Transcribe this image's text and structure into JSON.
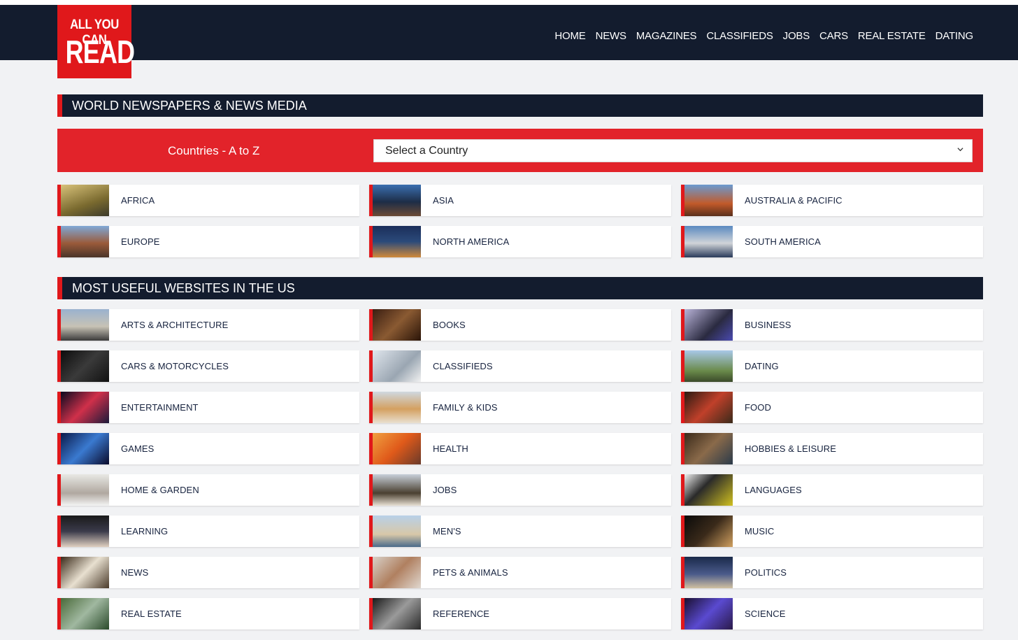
{
  "logo": {
    "line1": "ALL YOU CAN",
    "line2": "READ"
  },
  "nav": [
    "HOME",
    "NEWS",
    "MAGAZINES",
    "CLASSIFIEDS",
    "JOBS",
    "CARS",
    "REAL ESTATE",
    "DATING"
  ],
  "world_section": {
    "title": "WORLD NEWSPAPERS & NEWS MEDIA"
  },
  "countries": {
    "label": "Countries - A to Z",
    "select_value": "Select a Country"
  },
  "regions": [
    "AFRICA",
    "ASIA",
    "AUSTRALIA & PACIFIC",
    "EUROPE",
    "NORTH AMERICA",
    "SOUTH AMERICA"
  ],
  "us_section": {
    "title": "MOST USEFUL WEBSITES IN THE US"
  },
  "categories": [
    "ARTS & ARCHITECTURE",
    "BOOKS",
    "BUSINESS",
    "CARS & MOTORCYCLES",
    "CLASSIFIEDS",
    "DATING",
    "ENTERTAINMENT",
    "FAMILY & KIDS",
    "FOOD",
    "GAMES",
    "HEALTH",
    "HOBBIES & LEISURE",
    "HOME & GARDEN",
    "JOBS",
    "LANGUAGES",
    "LEARNING",
    "MEN'S",
    "MUSIC",
    "NEWS",
    "PETS & ANIMALS",
    "POLITICS",
    "REAL ESTATE",
    "REFERENCE",
    "SCIENCE"
  ],
  "colors": {
    "navy": "#131c2e",
    "red": "#e0181b",
    "page_bg": "#f1f2f4"
  }
}
